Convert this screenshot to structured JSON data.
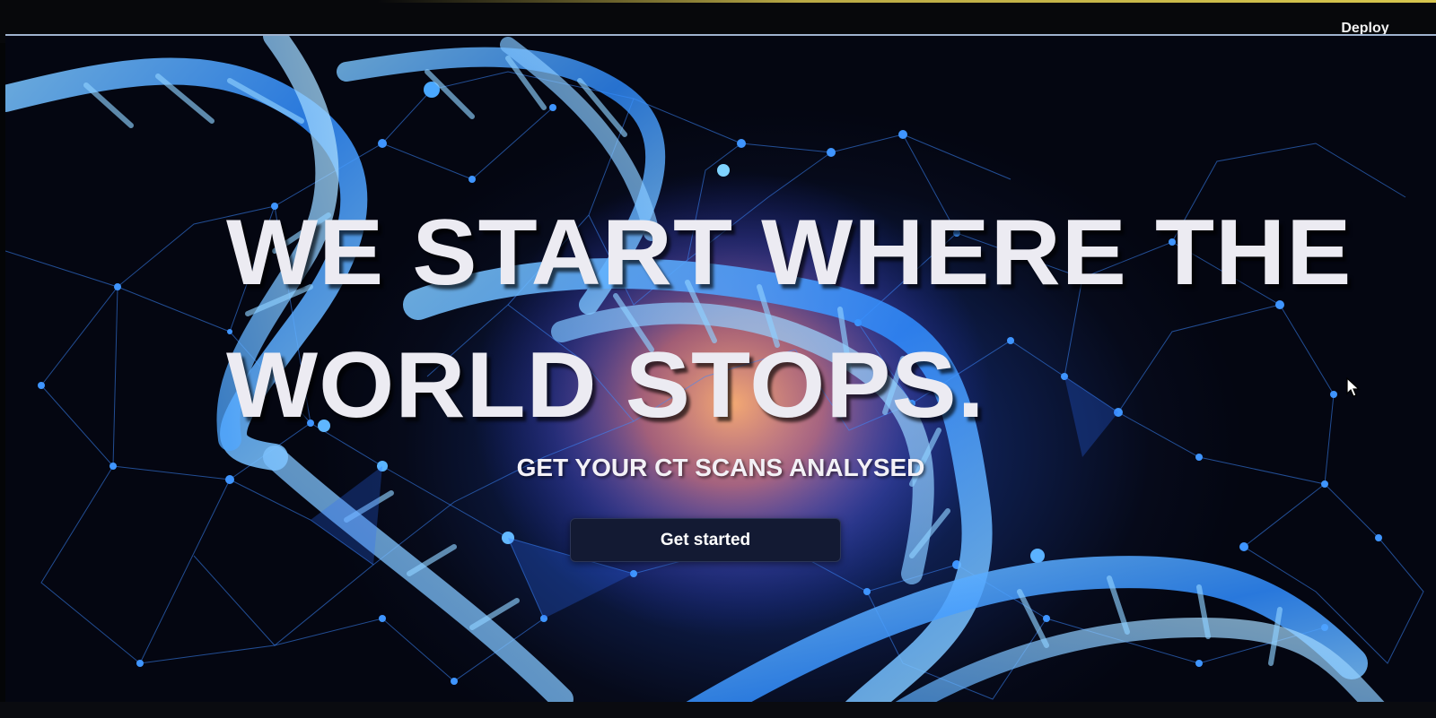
{
  "toolbar": {
    "deploy_label": "Deploy"
  },
  "hero": {
    "headline": "WE START WHERE THE WORLD STOPS.",
    "subheadline": "GET YOUR CT SCANS ANALYSED",
    "cta_label": "Get started",
    "background_image": "dna-double-helix-network-icon"
  },
  "colors": {
    "helix": "#3fa0ff",
    "network": "#2f7dff",
    "glow": "#ff9a5a",
    "button_bg": "#131a33",
    "headline": "#ecebf2"
  },
  "cursor": "mouse-pointer-icon"
}
